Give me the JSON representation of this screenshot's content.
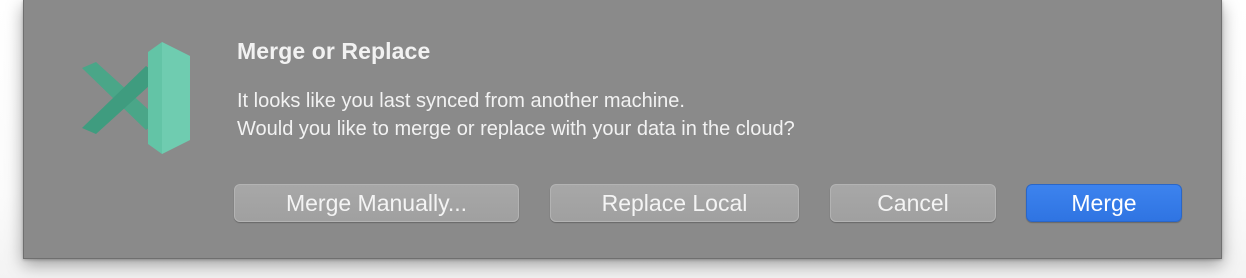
{
  "dialog": {
    "title": "Merge or Replace",
    "message_line1": "It looks like you last synced from another machine.",
    "message_line2": "Would you like to merge or replace with your data in the cloud?",
    "app_icon": "vscode-app-icon",
    "accent_color": "#3478e8",
    "icon_colors": [
      "#4aa688",
      "#63c4a6",
      "#7fd6bc"
    ]
  },
  "buttons": {
    "merge_manually": "Merge Manually...",
    "replace_local": "Replace Local",
    "cancel": "Cancel",
    "merge": "Merge"
  }
}
